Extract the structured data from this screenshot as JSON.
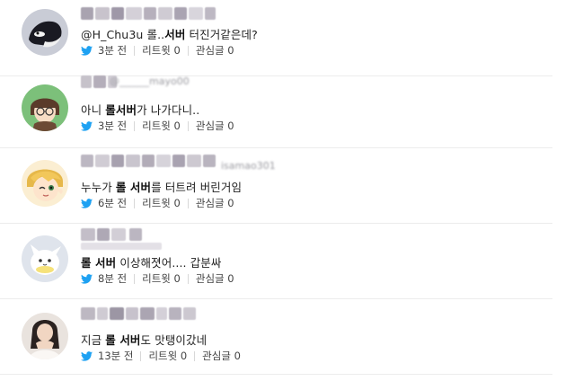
{
  "colors": {
    "twitter_blue": "#1da1f2",
    "text": "#222222",
    "divider": "#ececec"
  },
  "tweets": [
    {
      "avatar": "orca-avatar",
      "text_pre": "@H_Chu3u 롤..",
      "text_bold": "서버",
      "text_post": " 터진거같은데?",
      "time": "3분 전",
      "retweet": "리트윗 0",
      "fav": "관심글 0"
    },
    {
      "avatar": "glasses-boy-avatar",
      "text_pre": "아니 ",
      "text_bold": "롤서버",
      "text_post": "가 나가다니..",
      "time": "3분 전",
      "retweet": "리트윗 0",
      "fav": "관심글 0"
    },
    {
      "avatar": "blonde-winking-avatar",
      "text_pre": "누누가 ",
      "text_bold": "롤 서버",
      "text_post": "를 터트려 버린거임",
      "time": "6분 전",
      "retweet": "리트윗 0",
      "fav": "관심글 0"
    },
    {
      "avatar": "white-creature-avatar",
      "text_pre": "",
      "text_bold": "롤 서버",
      "text_post": " 이상해졋어.... 갑분싸",
      "time": "8분 전",
      "retweet": "리트윗 0",
      "fav": "관심글 0"
    },
    {
      "avatar": "photo-girl-avatar",
      "text_pre": "지금 ",
      "text_bold": "롤 서버",
      "text_post": "도 맛탱이갔네",
      "time": "13분 전",
      "retweet": "리트윗 0",
      "fav": "관심글 0"
    }
  ]
}
